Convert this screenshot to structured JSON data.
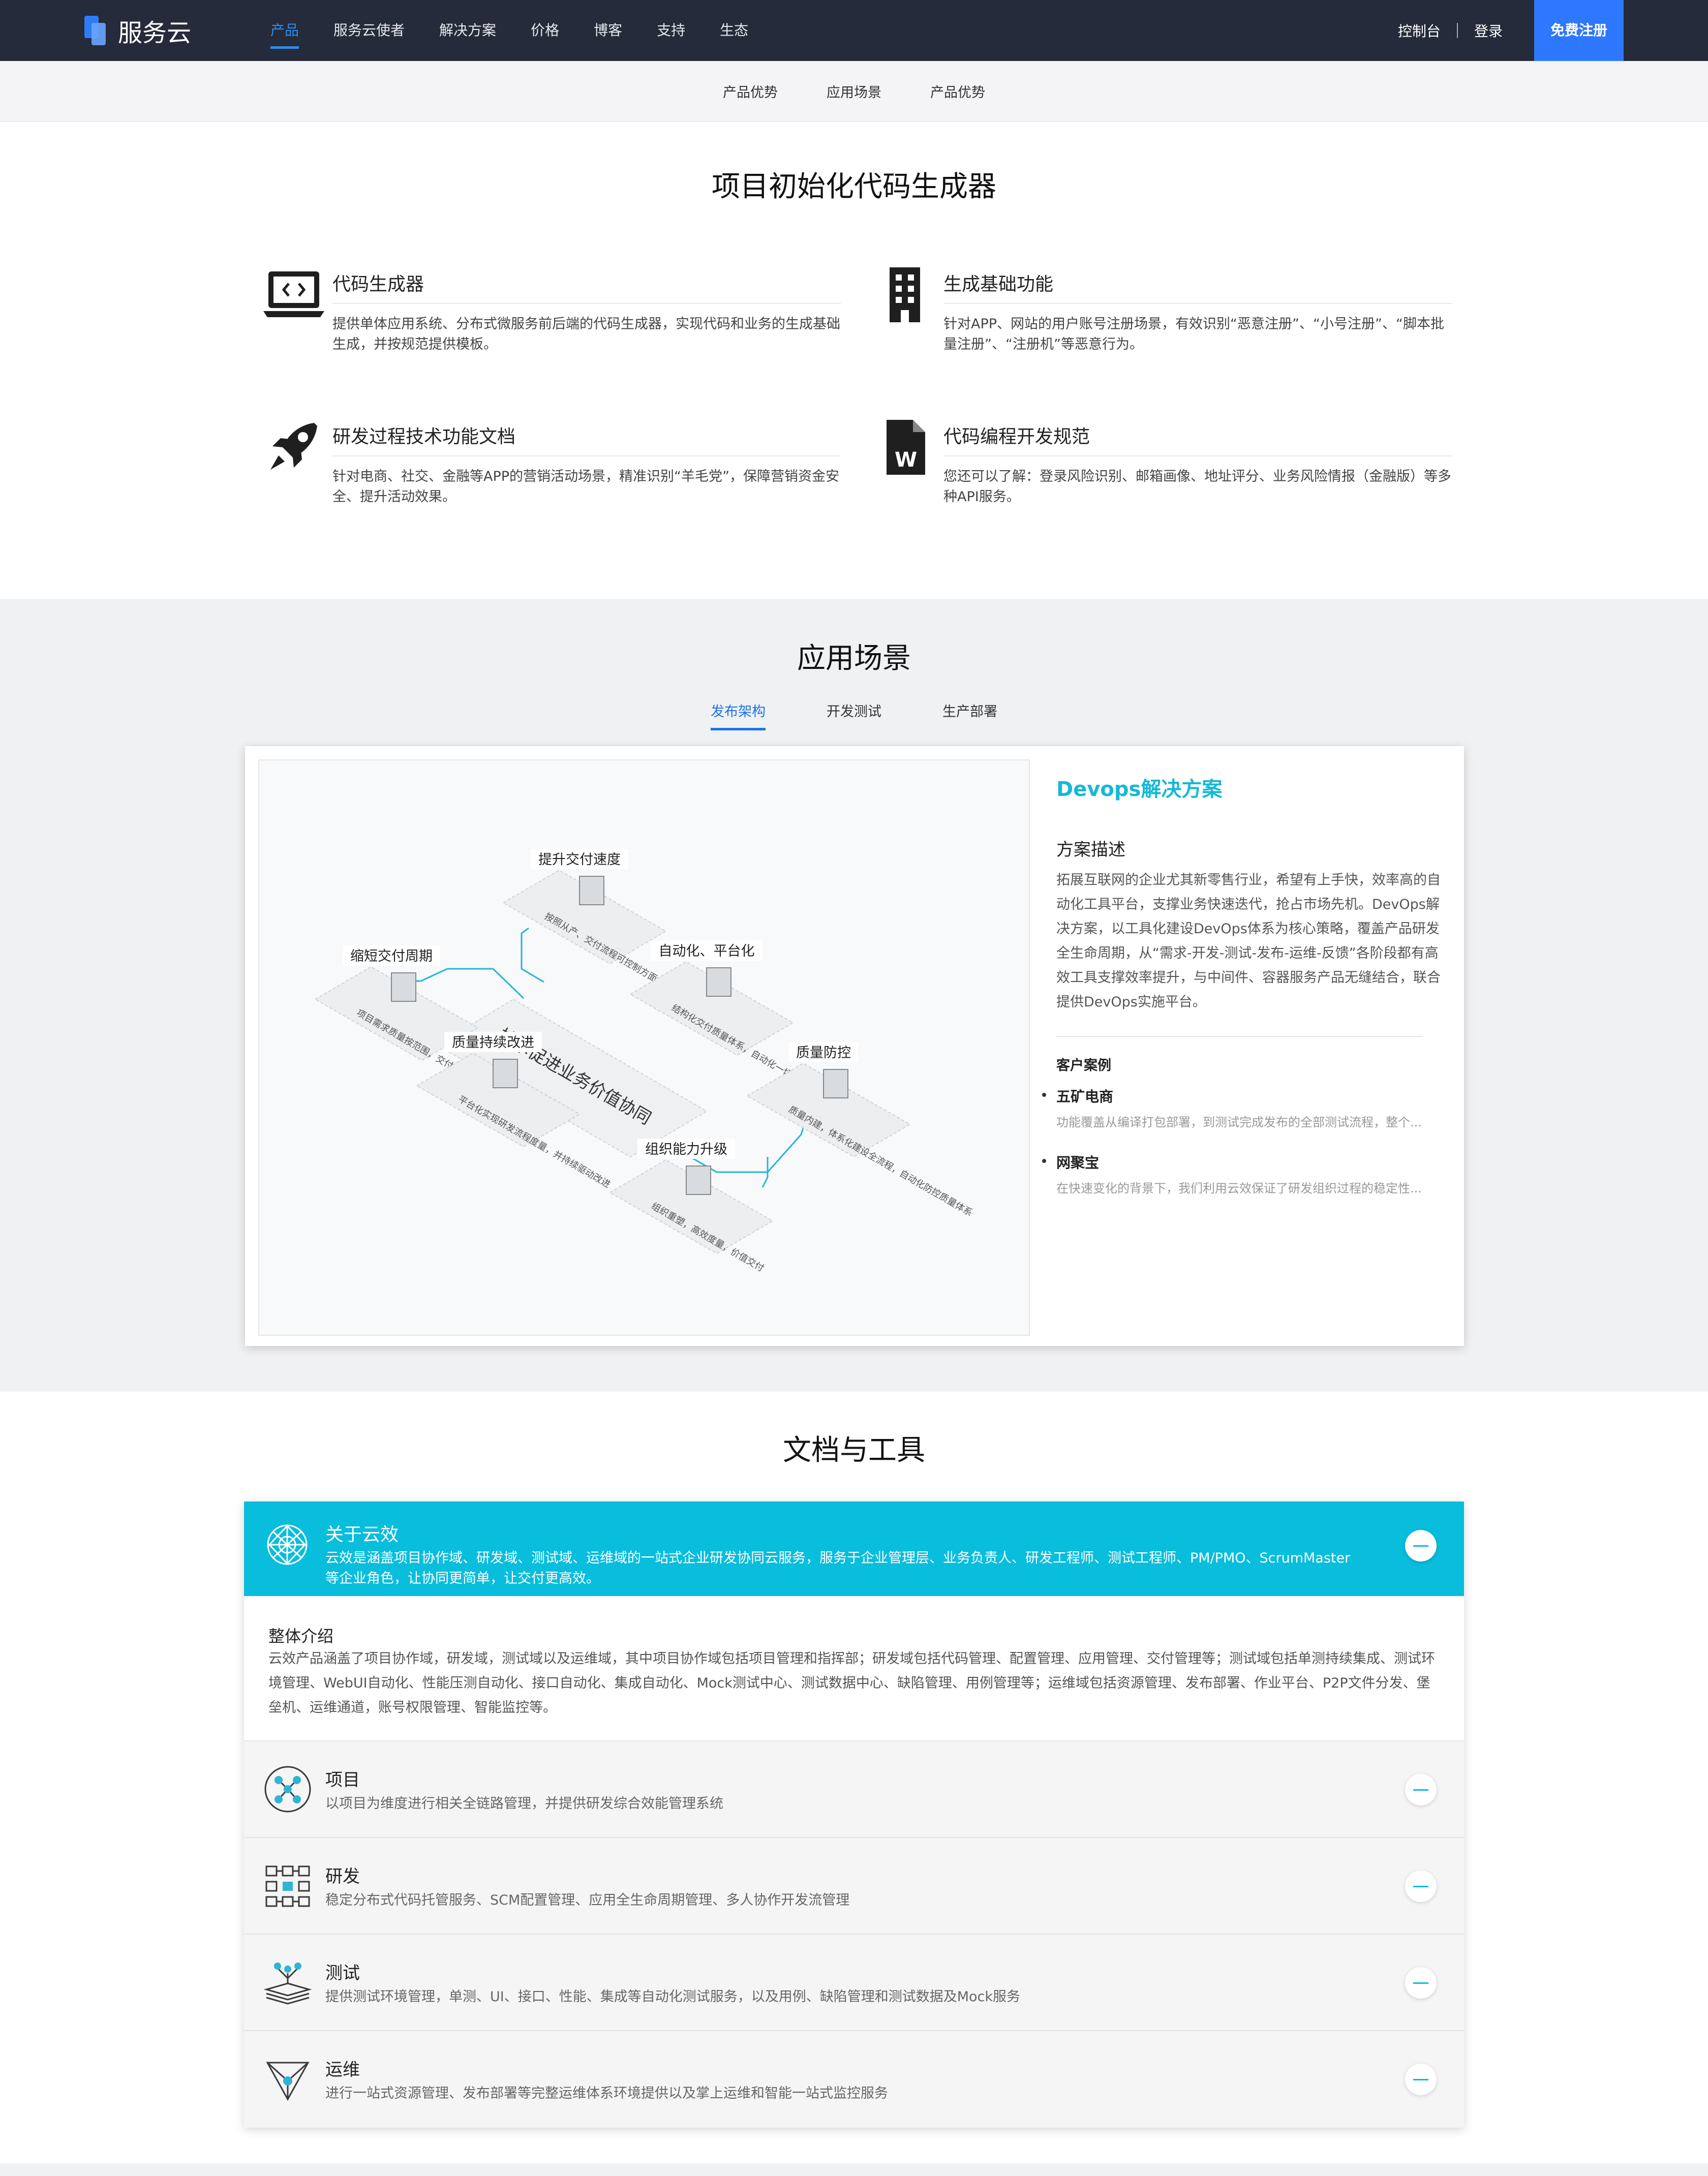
{
  "nav": {
    "brand": "服务云",
    "links": [
      "产品",
      "服务云使者",
      "解决方案",
      "价格",
      "博客",
      "支持",
      "生态"
    ],
    "console": "控制台",
    "login": "登录",
    "signup": "免费注册",
    "accent": "#2d8cf0"
  },
  "subnav": [
    "产品优势",
    "应用场景",
    "产品优势"
  ],
  "section1": {
    "title": "项目初始化代码生成器",
    "features": [
      {
        "icon": "laptop-code-icon",
        "title": "代码生成器",
        "desc": "提供单体应用系统、分布式微服务前后端的代码生成器，实现代码和业务的生成基础生成，并按规范提供模板。"
      },
      {
        "icon": "building-icon",
        "title": "生成基础功能",
        "desc": "针对APP、网站的用户账号注册场景，有效识别“恶意注册”、“小号注册”、“脚本批量注册”、“注册机”等恶意行为。"
      },
      {
        "icon": "rocket-icon",
        "title": "研发过程技术功能文档",
        "desc": "针对电商、社交、金融等APP的营销活动场景，精准识别“羊毛党”，保障营销资金安全、提升活动效果。"
      },
      {
        "icon": "word-document-icon",
        "title": "代码编程开发规范",
        "desc": "您还可以了解：登录风险识别、邮箱画像、地址评分、业务风险情报（金融版）等多种API服务。"
      }
    ]
  },
  "section2": {
    "title": "应用场景",
    "tabs": [
      "发布架构",
      "开发测试",
      "生产部署"
    ],
    "solution_title": "Devops解决方案",
    "desc_heading": "方案描述",
    "desc": "拓展互联网的企业尤其新零售行业，希望有上手快，效率高的自动化工具平台，支撑业务快速迭代，抢占市场先机。DevOps解决方案，以工具化建设DevOps体系为核心策略，覆盖产品研发全生命周期，从“需求-开发-测试-发布-运维-反馈”各阶段都有高效工具支撑效率提升，与中间件、容器服务产品无缝结合，联合提供DevOps实施平台。",
    "cases_heading": "客户案例",
    "cases": [
      {
        "name": "五矿电商",
        "desc": "功能覆盖从编译打包部署，到测试完成发布的全部测试流程，整个..."
      },
      {
        "name": "网聚宝",
        "desc": "在快速变化的背景下，我们利用云效保证了研发组织过程的稳定性..."
      }
    ],
    "diagram": {
      "center": "技术促进业务价值协同",
      "nodes": [
        {
          "label": "提升交付速度",
          "note": "按照从产、交付流程可控制方面，对接统一日常"
        },
        {
          "label": "自动化、平台化",
          "note": "结构化交付质量体系，自动化一切可以自动化的操作"
        },
        {
          "label": "缩短交付周期",
          "note": "项目需求质量按范围，交付可追溯，数据可度量"
        },
        {
          "label": "质量防控",
          "note": "质量内建，体系化建设全流程，自动化防控质量体系"
        },
        {
          "label": "质量持续改进",
          "note": "平台化实现研发流程度量，并持续驱动改进"
        },
        {
          "label": "组织能力升级",
          "note": "组织重塑，高效度量，价值交付"
        }
      ]
    }
  },
  "section3": {
    "title": "文档与工具",
    "header": {
      "icon": "network-sphere-icon",
      "title": "关于云效",
      "desc": "云效是涵盖项目协作域、研发域、测试域、运维域的一站式企业研发协同云服务，服务于企业管理层、业务负责人、研发工程师、测试工程师、PM/PMO、ScrumMaster等企业角色，让协同更简单，让交付更高效。"
    },
    "body": {
      "title": "整体介绍",
      "desc": "云效产品涵盖了项目协作域，研发域，测试域以及运维域，其中项目协作域包括项目管理和指挥部；研发域包括代码管理、配置管理、应用管理、交付管理等；测试域包括单测持续集成、测试环境管理、WebUI自动化、性能压测自动化、接口自动化、集成自动化、Mock测试中心、测试数据中心、缺陷管理、用例管理等；运维域包括资源管理、发布部署、作业平台、P2P文件分发、堡垒机、运维通道，账号权限管理、智能监控等。"
    },
    "rows": [
      {
        "icon": "project-nodes-icon",
        "title": "项目",
        "desc": "以项目为维度进行相关全链路管理，并提供研发综合效能管理系统"
      },
      {
        "icon": "dev-grid-icon",
        "title": "研发",
        "desc": "稳定分布式代码托管服务、SCM配置管理、应用全生命周期管理、多人协作开发流管理"
      },
      {
        "icon": "test-layers-icon",
        "title": "测试",
        "desc": "提供测试环境管理，单测、UI、接口、性能、集成等自动化测试服务，以及用例、缺陷管理和测试数据及Mock服务"
      },
      {
        "icon": "ops-triangle-icon",
        "title": "运维",
        "desc": "进行一站式资源管理、发布部署等完整运维体系环境提供以及掌上运维和智能一站式监控服务"
      }
    ],
    "accent": "#09bddc"
  }
}
